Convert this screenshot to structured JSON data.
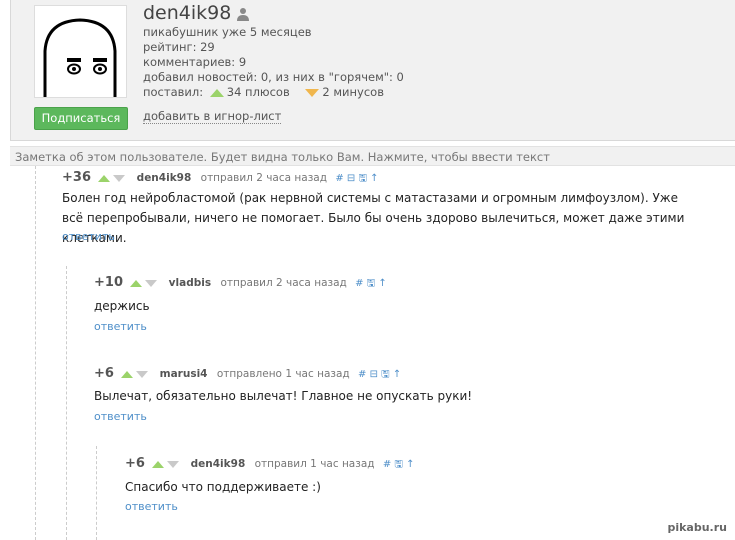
{
  "profile": {
    "username": "den4ik98",
    "since": "пикабушник уже 5 месяцев",
    "rating": "рейтинг: 29",
    "comments": "комментариев: 9",
    "news": "добавил новостей: 0, из них в \"горячем\": 0",
    "gave_label": "поставил:",
    "pluses": "34 плюсов",
    "minuses": "2 минусов",
    "subscribe": "Подписаться",
    "ignore": "добавить в игнор-лист"
  },
  "note": "Заметка об этом пользователе. Будет видна только Вам. Нажмите, чтобы ввести текст",
  "comments": [
    {
      "score": "+36",
      "author": "den4ik98",
      "meta": "отправил 2 часа назад",
      "icons": "# ⊟ 🖫 ↑",
      "text": "Болен год нейробластомой (рак нервной системы с матастазами и огромным лимфоузлом). Уже всё перепробывали, ничего не помогает. Было бы очень здорово вылечиться, может даже этими клетками.",
      "reply": "ответить"
    },
    {
      "score": "+10",
      "author": "vladbis",
      "meta": "отправил 2 часа назад",
      "icons": "# 🖫 ↑",
      "text": "держись",
      "reply": "ответить"
    },
    {
      "score": "+6",
      "author": "marusi4",
      "meta": "отправлено 1 час назад",
      "icons": "# ⊟ 🖫 ↑",
      "text": "Вылечат, обязательно вылечат! Главное не опускать руки!",
      "reply": "ответить"
    },
    {
      "score": "+6",
      "author": "den4ik98",
      "meta": "отправил 1 час назад",
      "icons": "# 🖫 ↑",
      "text": "Спасибо что поддерживаете :)",
      "reply": "ответить"
    }
  ],
  "watermark": "pikabu.ru",
  "colors": {
    "up": "#9bd36a",
    "down": "#c9c9c9",
    "link": "#4f8fc9",
    "subscribe": "#5cb85c"
  }
}
